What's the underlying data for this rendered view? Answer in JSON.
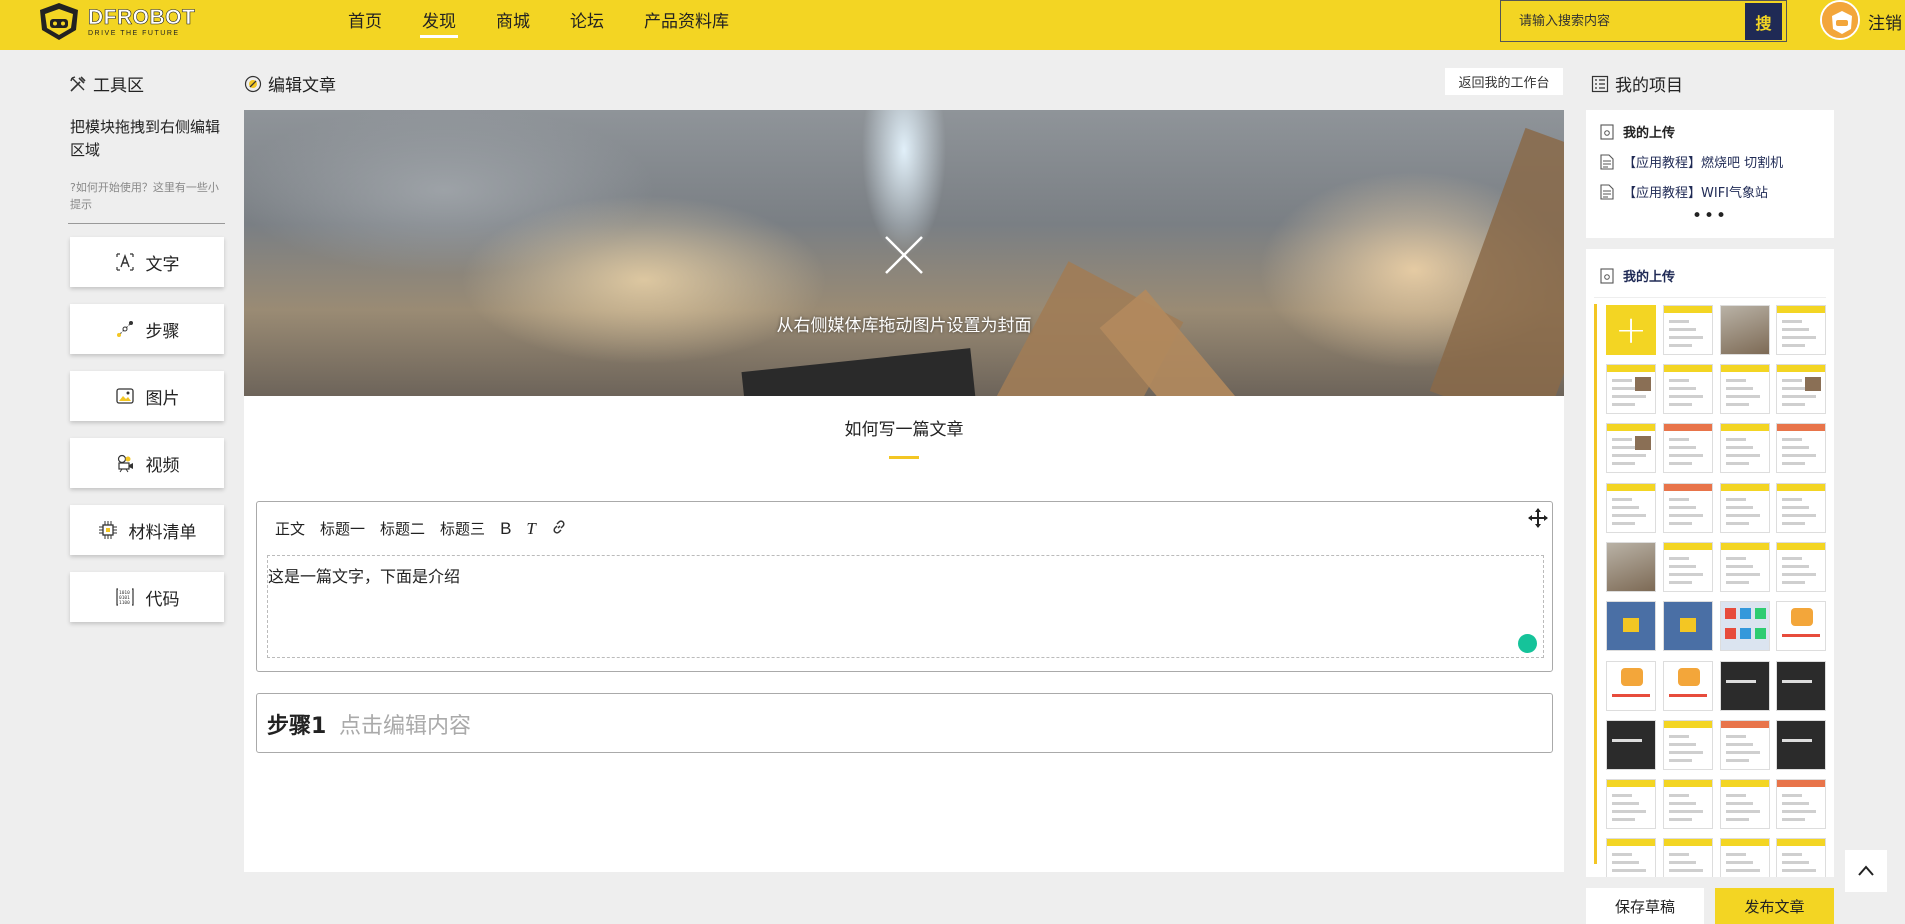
{
  "header": {
    "logo_text": "DFROBOT",
    "logo_sub": "DRIVE THE FUTURE",
    "nav": [
      {
        "label": "首页",
        "active": false
      },
      {
        "label": "发现",
        "active": true
      },
      {
        "label": "商城",
        "active": false
      },
      {
        "label": "论坛",
        "active": false
      },
      {
        "label": "产品资料库",
        "active": false
      }
    ],
    "search_placeholder": "请输入搜索内容",
    "search_button": "搜",
    "logout": "注销"
  },
  "tools": {
    "title": "工具区",
    "hint": "把模块拖拽到右侧编辑区域",
    "help": "?如何开始使用？这里有一些小提示",
    "items": [
      {
        "label": "文字",
        "icon": "text-icon"
      },
      {
        "label": "步骤",
        "icon": "steps-icon"
      },
      {
        "label": "图片",
        "icon": "image-icon"
      },
      {
        "label": "视频",
        "icon": "video-icon"
      },
      {
        "label": "材料清单",
        "icon": "chip-icon"
      },
      {
        "label": "代码",
        "icon": "code-icon"
      }
    ]
  },
  "editor": {
    "title": "编辑文章",
    "back_button": "返回我的工作台",
    "cover_hint": "从右侧媒体库拖动图片设置为封面",
    "article_title": "如何写一篇文章",
    "toolbar": [
      "正文",
      "标题一",
      "标题二",
      "标题三",
      "B",
      "T"
    ],
    "text_content": "这是一篇文字，下面是介绍",
    "step_label": "步骤1",
    "step_placeholder": "点击编辑内容"
  },
  "projects": {
    "title": "我的项目",
    "upload_label": "我的上传",
    "items": [
      "【应用教程】燃烧吧 切割机",
      "【应用教程】WIFI气象站"
    ],
    "more": "•••"
  },
  "media": {
    "title": "我的上传",
    "add_label": "+"
  },
  "actions": {
    "save": "保存草稿",
    "publish": "发布文章"
  },
  "colors": {
    "brand_yellow": "#f3d523",
    "navy": "#1f2a55"
  }
}
